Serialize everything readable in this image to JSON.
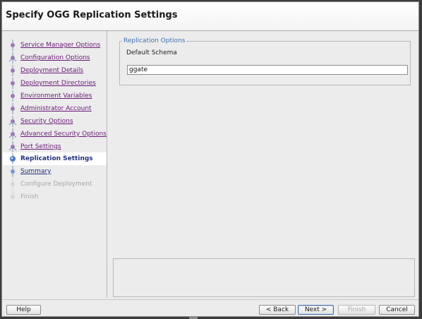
{
  "header": {
    "title": "Specify OGG Replication Settings"
  },
  "steps": [
    {
      "label": "Service Manager Options",
      "state": "visited"
    },
    {
      "label": "Configuration Options",
      "state": "visited"
    },
    {
      "label": "Deployment Details",
      "state": "visited"
    },
    {
      "label": "Deployment Directories",
      "state": "visited"
    },
    {
      "label": "Environment Variables",
      "state": "visited"
    },
    {
      "label": "Administrator Account",
      "state": "visited"
    },
    {
      "label": "Security Options",
      "state": "visited"
    },
    {
      "label": "Advanced Security Options",
      "state": "visited"
    },
    {
      "label": "Port Settings",
      "state": "visited"
    },
    {
      "label": "Replication Settings",
      "state": "current"
    },
    {
      "label": "Summary",
      "state": "next"
    },
    {
      "label": "Configure Deployment",
      "state": "disabled"
    },
    {
      "label": "Finish",
      "state": "disabled"
    }
  ],
  "replication": {
    "legend": "Replication Options",
    "schema_label": "Default Schema",
    "schema_value": "ggate"
  },
  "buttons": {
    "help": "Help",
    "back": "< Back",
    "next": "Next >",
    "finish": "Finish",
    "cancel": "Cancel"
  },
  "colors": {
    "visited_link": "#6a1a78",
    "current_step": "#23307a",
    "disabled_text": "#a8a8a8",
    "legend_text": "#3c6fb0"
  }
}
